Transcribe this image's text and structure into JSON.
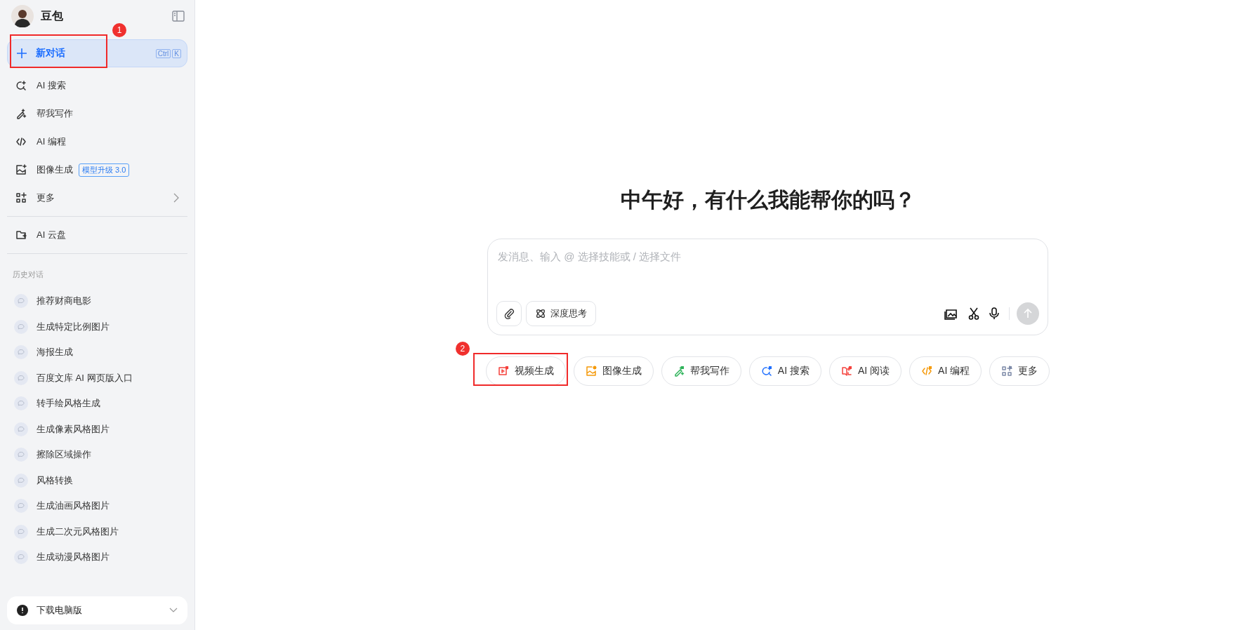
{
  "app": {
    "name": "豆包"
  },
  "new_chat": {
    "label": "新对话",
    "shortcut": [
      "Ctrl",
      "K"
    ],
    "selected": true,
    "callout": "1"
  },
  "nav": [
    {
      "label": "AI 搜索",
      "kind": "search",
      "selected": false
    },
    {
      "label": "帮我写作",
      "kind": "write",
      "selected": false
    },
    {
      "label": "AI 编程",
      "kind": "code",
      "selected": false
    },
    {
      "label": "图像生成",
      "kind": "image",
      "badge": "模型升级 3.0",
      "selected": false
    },
    {
      "label": "更多",
      "kind": "more",
      "expandable": true,
      "selected": false
    }
  ],
  "drive": {
    "label": "AI 云盘",
    "selected": false
  },
  "history": {
    "heading": "历史对话",
    "items": [
      "推荐财商电影",
      "生成特定比例图片",
      "海报生成",
      "百度文库 AI 网页版入口",
      "转手绘风格生成",
      "生成像素风格图片",
      "擦除区域操作",
      "风格转换",
      "生成油画风格图片",
      "生成二次元风格图片",
      "生成动漫风格图片"
    ]
  },
  "download": {
    "label": "下载电脑版"
  },
  "greeting": "中午好，有什么我能帮你的吗？",
  "composer": {
    "placeholder": "发消息、输入 @ 选择技能或 / 选择文件",
    "deep_think": {
      "label": "深度思考",
      "selected": false
    }
  },
  "skills": [
    {
      "label": "视频生成",
      "kind": "video",
      "color": "#f5413c",
      "callout": "2"
    },
    {
      "label": "图像生成",
      "kind": "image",
      "color": "#f59a0b"
    },
    {
      "label": "帮我写作",
      "kind": "write",
      "color": "#2fb35a"
    },
    {
      "label": "AI 搜索",
      "kind": "search",
      "color": "#1e6fff"
    },
    {
      "label": "AI 阅读",
      "kind": "read",
      "color": "#f5413c"
    },
    {
      "label": "AI 编程",
      "kind": "code",
      "color": "#f59a0b"
    },
    {
      "label": "更多",
      "kind": "more",
      "color": "#7d8aa8"
    }
  ]
}
